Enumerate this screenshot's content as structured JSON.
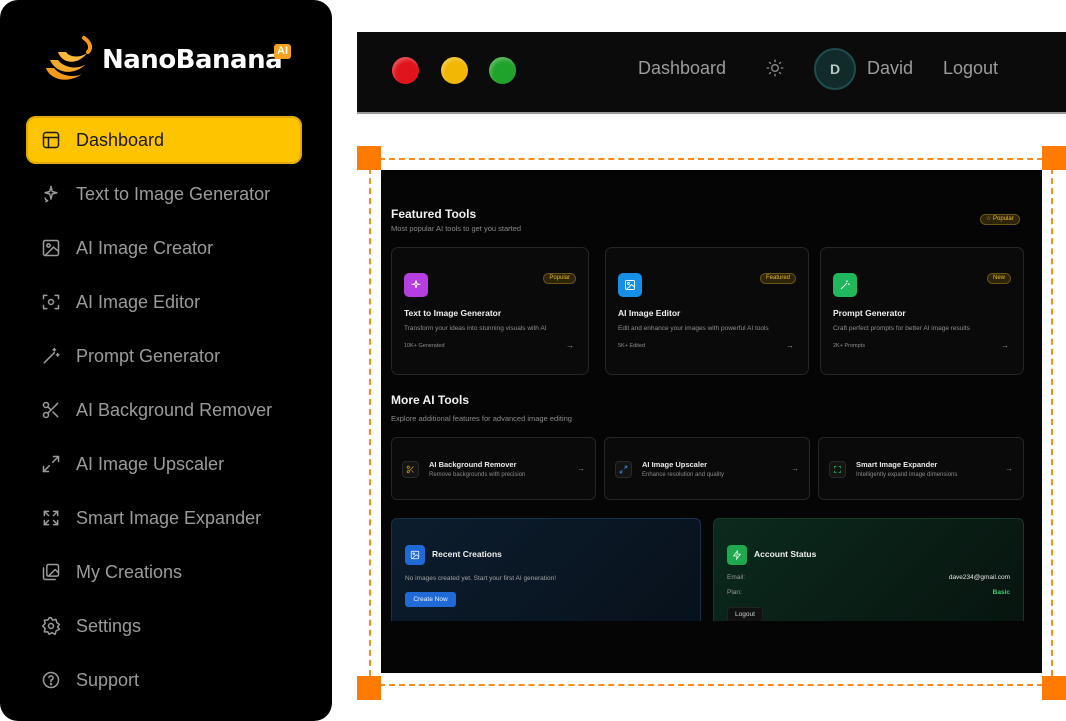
{
  "brand": {
    "name": "NanoBanana",
    "badge": "AI"
  },
  "sidebar": {
    "items": [
      {
        "label": "Dashboard",
        "icon": "dashboard-icon",
        "active": true
      },
      {
        "label": "Text to Image Generator",
        "icon": "sparkles-icon"
      },
      {
        "label": "AI Image Creator",
        "icon": "image-icon"
      },
      {
        "label": "AI Image Editor",
        "icon": "scan-icon"
      },
      {
        "label": "Prompt Generator",
        "icon": "wand-icon"
      },
      {
        "label": "AI Background Remover",
        "icon": "scissors-icon"
      },
      {
        "label": "AI Image Upscaler",
        "icon": "expand-arrows-icon"
      },
      {
        "label": "Smart Image Expander",
        "icon": "maximize-icon"
      },
      {
        "label": "My Creations",
        "icon": "gallery-icon"
      },
      {
        "label": "Settings",
        "icon": "gear-icon"
      },
      {
        "label": "Support",
        "icon": "help-icon"
      }
    ]
  },
  "topbar": {
    "dashboard": "Dashboard",
    "avatar_initial": "D",
    "user": "David",
    "logout": "Logout"
  },
  "featured": {
    "title": "Featured Tools",
    "subtitle": "Most popular AI tools to get you started",
    "badge": "☆ Popular",
    "cards": [
      {
        "title": "Text to Image Generator",
        "desc": "Transform your ideas into stunning visuals with AI",
        "stat": "10K+ Generated",
        "tag": "Popular",
        "color": "#b43ee0"
      },
      {
        "title": "AI Image Editor",
        "desc": "Edit and enhance your images with powerful AI tools",
        "stat": "5K+ Edited",
        "tag": "Featured",
        "color": "#1590e6"
      },
      {
        "title": "Prompt Generator",
        "desc": "Craft perfect prompts for better AI image results",
        "stat": "2K+ Prompts",
        "tag": "New",
        "color": "#1fb85a"
      }
    ]
  },
  "more": {
    "title": "More AI Tools",
    "subtitle": "Explore additional features for advanced image editing",
    "items": [
      {
        "title": "AI Background Remover",
        "desc": "Remove backgrounds with precision",
        "icon_color": "#e0a020"
      },
      {
        "title": "AI Image Upscaler",
        "desc": "Enhance resolution and quality",
        "icon_color": "#3a8ee6"
      },
      {
        "title": "Smart Image Expander",
        "desc": "Intelligently expand image dimensions",
        "icon_color": "#2fb863"
      }
    ]
  },
  "recent": {
    "title": "Recent Creations",
    "empty_text": "No images created yet. Start your first AI generation!",
    "button": "Create Now"
  },
  "account": {
    "title": "Account Status",
    "email_label": "Email:",
    "email": "dave234@gmail.com",
    "plan_label": "Plan:",
    "plan": "Basic",
    "logout": "Logout"
  },
  "colors": {
    "accent": "#ffc400",
    "selection": "#ff7a00"
  }
}
